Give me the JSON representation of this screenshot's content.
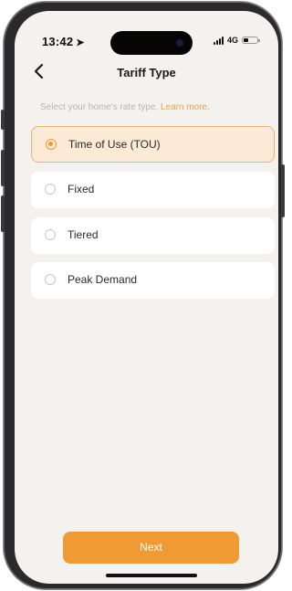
{
  "status_bar": {
    "time": "13:42",
    "location_icon": "location-arrow-icon",
    "network": "4G",
    "battery_level": 0.35
  },
  "nav": {
    "back_icon": "chevron-left-icon",
    "title": "Tariff Type"
  },
  "hint": {
    "text": "Select your home's rate type.",
    "link": "Learn more."
  },
  "options": [
    {
      "label": "Time of Use (TOU)",
      "selected": true
    },
    {
      "label": "Fixed",
      "selected": false
    },
    {
      "label": "Tiered",
      "selected": false
    },
    {
      "label": "Peak Demand",
      "selected": false
    }
  ],
  "actions": {
    "next_label": "Next"
  },
  "colors": {
    "accent": "#f09a34",
    "selected_bg": "#fbead6",
    "selected_border": "#eeb46c",
    "background": "#f4f2ef"
  }
}
